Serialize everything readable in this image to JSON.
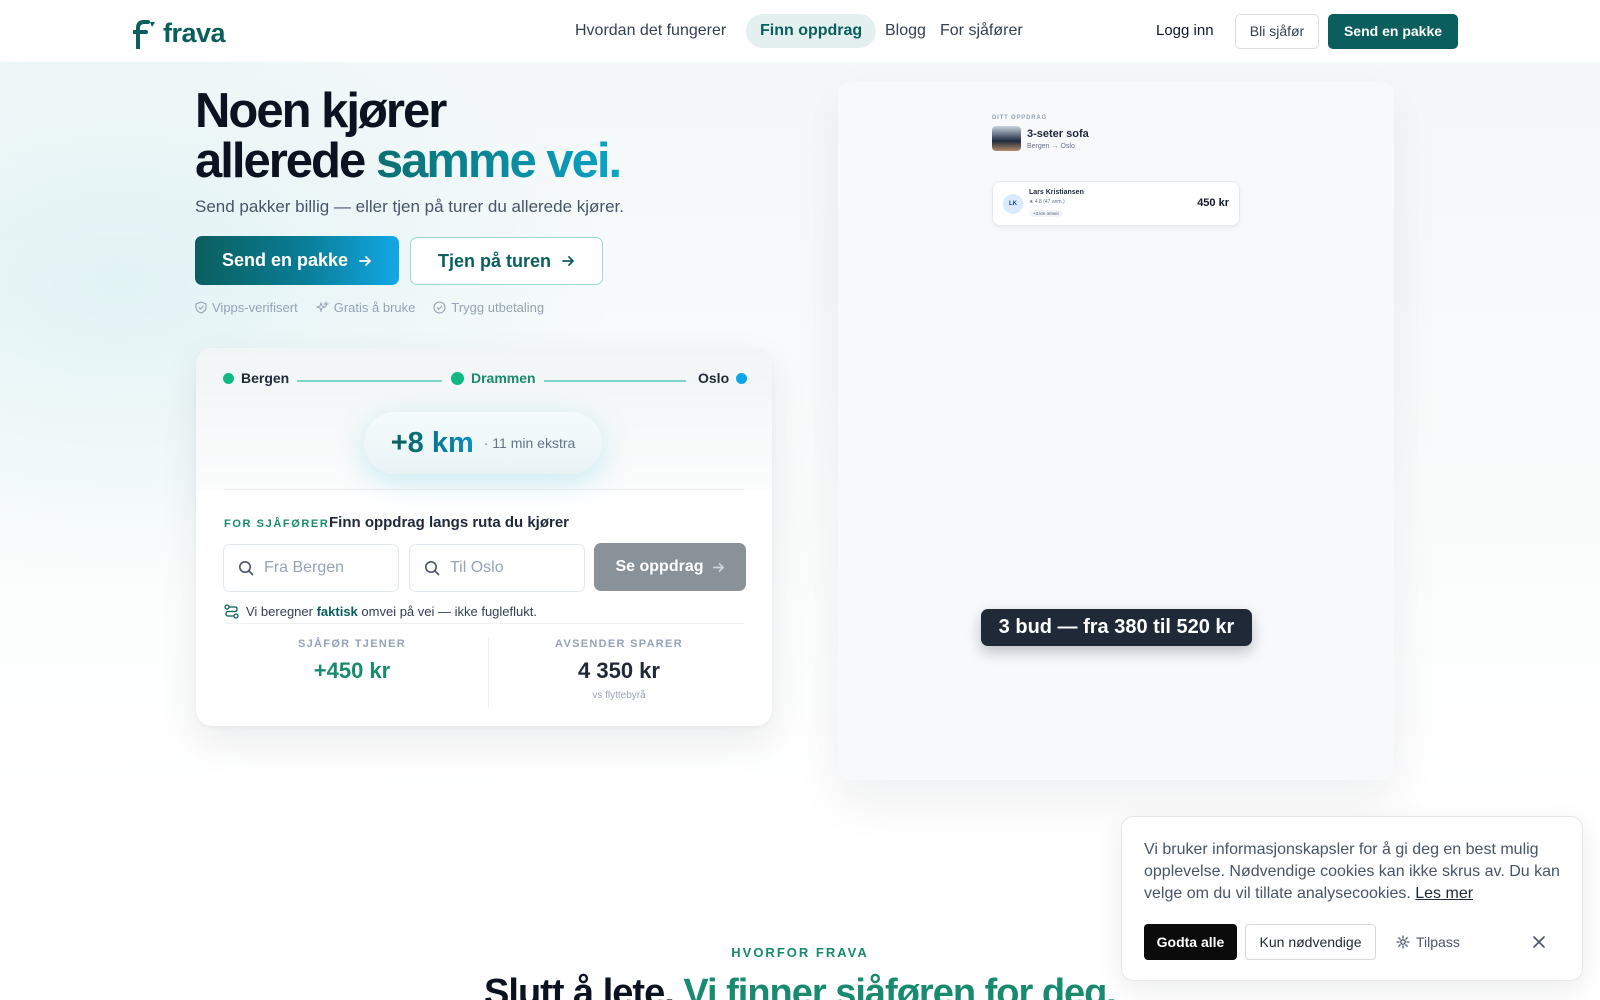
{
  "brand": {
    "name": "frava",
    "accent": "#0b5e5e",
    "accent2": "#12a8e6",
    "green": "#178a6f"
  },
  "nav": {
    "links": [
      {
        "label": "Hvordan det fungerer"
      },
      {
        "label": "Finn oppdrag",
        "active": true
      },
      {
        "label": "Blogg"
      },
      {
        "label": "For sjåfører"
      }
    ],
    "login": "Logg inn",
    "become_driver": "Bli sjåfør",
    "send_package": "Send en pakke"
  },
  "hero": {
    "title_line1": "Noen kjører",
    "title_line2_plain": "allerede ",
    "title_line2_accent": "samme vei.",
    "subtitle": "Send pakker billig — eller tjen på turer du allerede kjører.",
    "cta_primary": "Send en pakke",
    "cta_secondary": "Tjen på turen",
    "badges": [
      {
        "icon": "shield-check-icon",
        "label": "Vipps-verifisert"
      },
      {
        "icon": "sparkles-icon",
        "label": "Gratis å bruke"
      },
      {
        "icon": "check-circle-icon",
        "label": "Trygg utbetaling"
      }
    ]
  },
  "route_card": {
    "stops": [
      {
        "name": "Bergen",
        "color": "#10b981"
      },
      {
        "name": "Drammen",
        "color": "#10b981"
      },
      {
        "name": "Oslo",
        "color": "#0ea5e9"
      }
    ],
    "extra_km": "+8 km",
    "extra_time": "· 11 min ekstra",
    "for_label": "FOR SJÅFØRER",
    "for_text": "Finn oppdrag langs ruta du kjører",
    "from_placeholder": "Fra Bergen",
    "to_placeholder": "Til Oslo",
    "search_button": "Se oppdrag",
    "calc_pre": "Vi beregner ",
    "calc_bold1": "faktisk",
    "calc_mid": " omvei på vei",
    "calc_post": " — ikke fugleflukt.",
    "stats": [
      {
        "label": "SJÅFØR TJENER",
        "value": "+450 kr",
        "color": "#178a6f",
        "sub": ""
      },
      {
        "label": "AVSENDER SPARER",
        "value": "4 350 kr",
        "color": "#1f2937",
        "sub": "vs flyttebyrå"
      }
    ]
  },
  "preview": {
    "label": "DITT OPPDRAG",
    "item_title": "3-seter sofa",
    "item_route": "Bergen → Oslo",
    "bid": {
      "initials": "LK",
      "name": "Lars Kristiansen",
      "rating": "★ 4.8 (47 anm.)",
      "extra": "+3 km omvei",
      "price": "450 kr"
    },
    "bids_summary": "3 bud — fra 380 til 520 kr"
  },
  "why": {
    "label": "HVORFOR FRAVA",
    "title_plain": "Slutt å lete. ",
    "title_accent": "Vi finner sjåføren for deg."
  },
  "cookie": {
    "text": "Vi bruker informasjonskapsler for å gi deg en best mulig opplevelse. Nødvendige cookies kan ikke skrus av. Du kan velge om du vil tillate analysecookies. ",
    "read_more": "Les mer",
    "accept_all": "Godta alle",
    "necessary_only": "Kun nødvendige",
    "customize": "Tilpass"
  }
}
